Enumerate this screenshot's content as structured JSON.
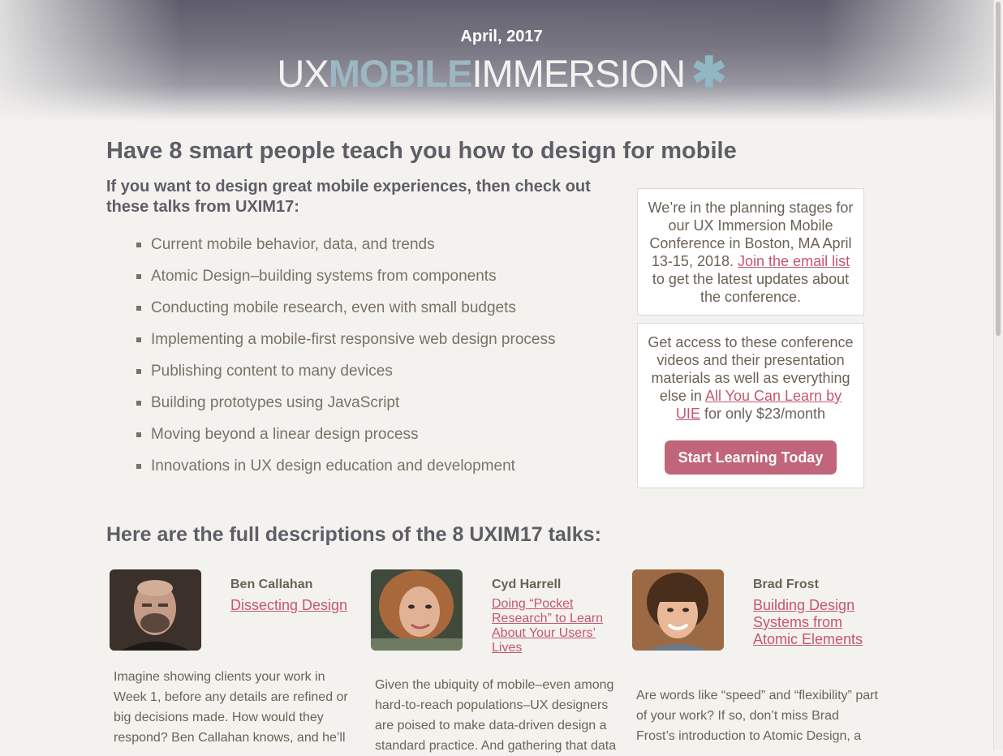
{
  "header": {
    "date": "April, 2017",
    "logo": {
      "ux": "UX",
      "mobile": "MOBILE",
      "immersion": "IMMERSION",
      "asterisk": "✱"
    }
  },
  "main": {
    "title": "Have 8 smart people teach you how to design for mobile",
    "intro": "If you want to design great mobile experiences, then check out these talks from UXIM17:",
    "topics": [
      "Current mobile behavior, data, and trends",
      "Atomic Design–building systems from components",
      "Conducting mobile research, even with small budgets",
      "Implementing a mobile-first responsive web design process",
      "Publishing content to many devices",
      "Building prototypes using JavaScript",
      "Moving beyond a linear design process",
      "Innovations in UX design education and development"
    ]
  },
  "sidebar": {
    "box1": {
      "text_before": "We’re in the planning stages for our UX Immersion Mobile Conference in Boston, MA April 13-15, 2018.",
      "link": "Join the email list",
      "text_after": "to get the latest updates about the conference."
    },
    "box2": {
      "text_before": "Get access to these conference videos and their presentation materials as well as everything else in",
      "link": "All You Can Learn by UIE",
      "text_after": "for only $23/month",
      "button": "Start Learning Today"
    }
  },
  "talks_section": {
    "title": "Here are the full descriptions of the 8 UXIM17 talks:",
    "speakers": [
      {
        "name": "Ben Callahan",
        "talk": "Dissecting Design",
        "description": "Imagine showing clients your work in Week 1, before any details are refined or big decisions made. How would they respond? Ben Callahan knows, and he’ll"
      },
      {
        "name": "Cyd Harrell",
        "talk": "Doing “Pocket Research” to Learn About Your Users’ Lives",
        "description": "Given the ubiquity of mobile–even among hard-to-reach populations–UX designers are poised to make data-driven design a standard practice. And gathering that data"
      },
      {
        "name": "Brad Frost",
        "talk": "Building Design Systems from Atomic Elements",
        "description": "Are words like “speed” and “flexibility” part of your work? If so, don’t miss Brad Frost’s introduction to Atomic Design, a"
      }
    ]
  },
  "colors": {
    "accent": "#c5566f",
    "button": "#c1657a",
    "heading": "#5f5d66",
    "body": "#6b6256"
  }
}
